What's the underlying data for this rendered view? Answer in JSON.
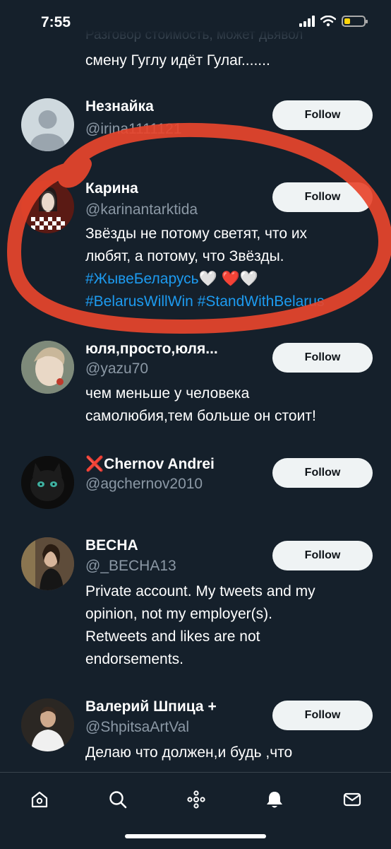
{
  "status": {
    "time": "7:55"
  },
  "top_text": {
    "faded": "Разговор стоимость, может дьявол",
    "line": "смену Гуглу идёт Гулаг......."
  },
  "users": [
    {
      "name": "Незнайка",
      "handle": "@irina1111121",
      "follow": "Follow",
      "bio": []
    },
    {
      "name": "Карина",
      "handle": "@karinantarktida",
      "follow": "Follow",
      "bio": [
        "Звёзды не потому светят, что их",
        "любят, а потому, что Звёзды.",
        "#ЖывеБеларусь🤍 ❤️🤍",
        "#BelarusWillWin #StandWithBelarus"
      ]
    },
    {
      "name": "юля,просто,юля...",
      "handle": "@yazu70",
      "follow": "Follow",
      "bio": [
        "чем меньше у человека",
        "самолюбия,тем больше он стоит!"
      ]
    },
    {
      "name": "❌Chernov Andrei",
      "handle": "@agchernov2010",
      "follow": "Follow",
      "bio": []
    },
    {
      "name": "ВЕСНА",
      "handle": "@_BECHA13",
      "follow": "Follow",
      "bio": [
        "Private account. My tweets and my",
        "opinion, not my employer(s).",
        "Retweets and likes are not",
        "endorsements."
      ]
    },
    {
      "name": "Валерий Шпица +",
      "handle": "@ShpitsaArtVal",
      "follow": "Follow",
      "bio": [
        "Делаю что должен,и будь ,что"
      ]
    }
  ],
  "colors": {
    "background": "#15202b",
    "handle": "#8b98a5",
    "annotation": "#e8452c",
    "follow_bg": "#eff3f4"
  },
  "tabs": [
    "home-icon",
    "search-icon",
    "spaces-icon",
    "notifications-icon",
    "messages-icon"
  ]
}
